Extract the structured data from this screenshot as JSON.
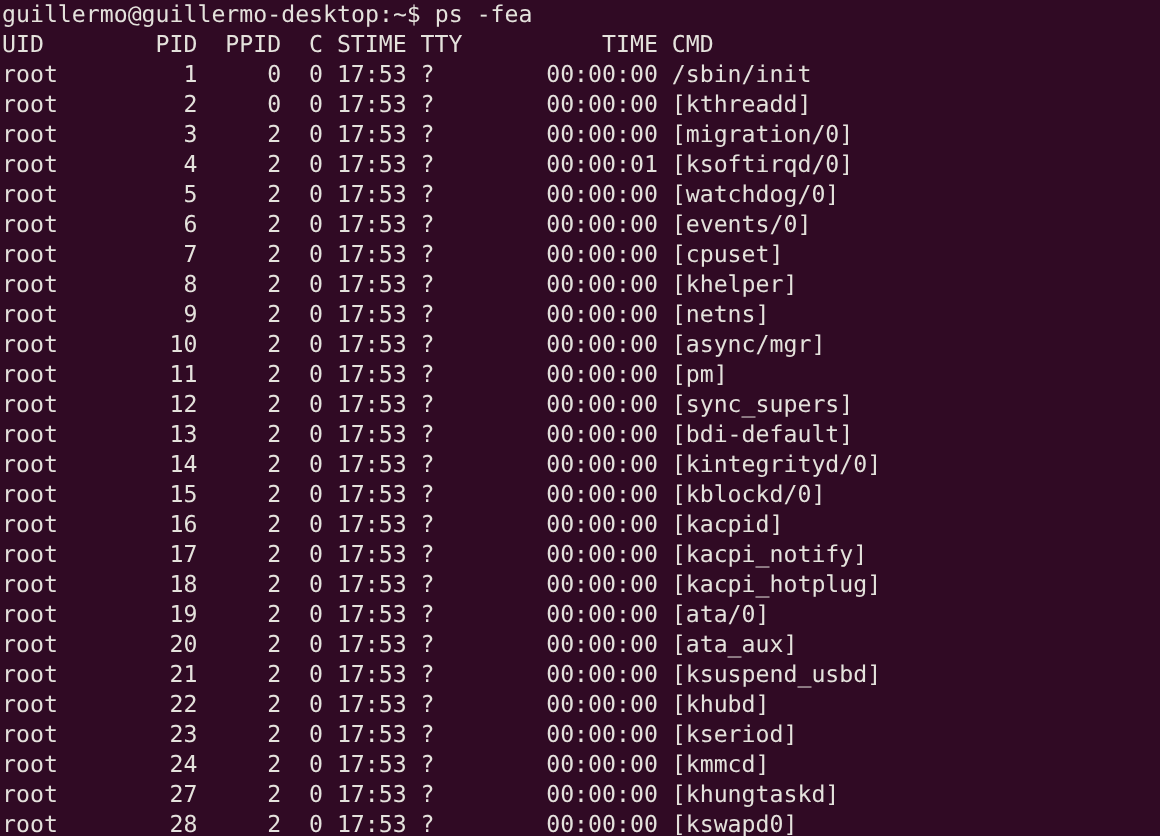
{
  "prompt": "guillermo@guillermo-desktop:~$ ps -fea",
  "columns": [
    "UID",
    "PID",
    "PPID",
    "C",
    "STIME",
    "TTY",
    "TIME",
    "CMD"
  ],
  "rows": [
    [
      "root",
      "1",
      "0",
      "0",
      "17:53",
      "?",
      "00:00:00",
      "/sbin/init"
    ],
    [
      "root",
      "2",
      "0",
      "0",
      "17:53",
      "?",
      "00:00:00",
      "[kthreadd]"
    ],
    [
      "root",
      "3",
      "2",
      "0",
      "17:53",
      "?",
      "00:00:00",
      "[migration/0]"
    ],
    [
      "root",
      "4",
      "2",
      "0",
      "17:53",
      "?",
      "00:00:01",
      "[ksoftirqd/0]"
    ],
    [
      "root",
      "5",
      "2",
      "0",
      "17:53",
      "?",
      "00:00:00",
      "[watchdog/0]"
    ],
    [
      "root",
      "6",
      "2",
      "0",
      "17:53",
      "?",
      "00:00:00",
      "[events/0]"
    ],
    [
      "root",
      "7",
      "2",
      "0",
      "17:53",
      "?",
      "00:00:00",
      "[cpuset]"
    ],
    [
      "root",
      "8",
      "2",
      "0",
      "17:53",
      "?",
      "00:00:00",
      "[khelper]"
    ],
    [
      "root",
      "9",
      "2",
      "0",
      "17:53",
      "?",
      "00:00:00",
      "[netns]"
    ],
    [
      "root",
      "10",
      "2",
      "0",
      "17:53",
      "?",
      "00:00:00",
      "[async/mgr]"
    ],
    [
      "root",
      "11",
      "2",
      "0",
      "17:53",
      "?",
      "00:00:00",
      "[pm]"
    ],
    [
      "root",
      "12",
      "2",
      "0",
      "17:53",
      "?",
      "00:00:00",
      "[sync_supers]"
    ],
    [
      "root",
      "13",
      "2",
      "0",
      "17:53",
      "?",
      "00:00:00",
      "[bdi-default]"
    ],
    [
      "root",
      "14",
      "2",
      "0",
      "17:53",
      "?",
      "00:00:00",
      "[kintegrityd/0]"
    ],
    [
      "root",
      "15",
      "2",
      "0",
      "17:53",
      "?",
      "00:00:00",
      "[kblockd/0]"
    ],
    [
      "root",
      "16",
      "2",
      "0",
      "17:53",
      "?",
      "00:00:00",
      "[kacpid]"
    ],
    [
      "root",
      "17",
      "2",
      "0",
      "17:53",
      "?",
      "00:00:00",
      "[kacpi_notify]"
    ],
    [
      "root",
      "18",
      "2",
      "0",
      "17:53",
      "?",
      "00:00:00",
      "[kacpi_hotplug]"
    ],
    [
      "root",
      "19",
      "2",
      "0",
      "17:53",
      "?",
      "00:00:00",
      "[ata/0]"
    ],
    [
      "root",
      "20",
      "2",
      "0",
      "17:53",
      "?",
      "00:00:00",
      "[ata_aux]"
    ],
    [
      "root",
      "21",
      "2",
      "0",
      "17:53",
      "?",
      "00:00:00",
      "[ksuspend_usbd]"
    ],
    [
      "root",
      "22",
      "2",
      "0",
      "17:53",
      "?",
      "00:00:00",
      "[khubd]"
    ],
    [
      "root",
      "23",
      "2",
      "0",
      "17:53",
      "?",
      "00:00:00",
      "[kseriod]"
    ],
    [
      "root",
      "24",
      "2",
      "0",
      "17:53",
      "?",
      "00:00:00",
      "[kmmcd]"
    ],
    [
      "root",
      "27",
      "2",
      "0",
      "17:53",
      "?",
      "00:00:00",
      "[khungtaskd]"
    ],
    [
      "root",
      "28",
      "2",
      "0",
      "17:53",
      "?",
      "00:00:00",
      "[kswapd0]"
    ]
  ]
}
